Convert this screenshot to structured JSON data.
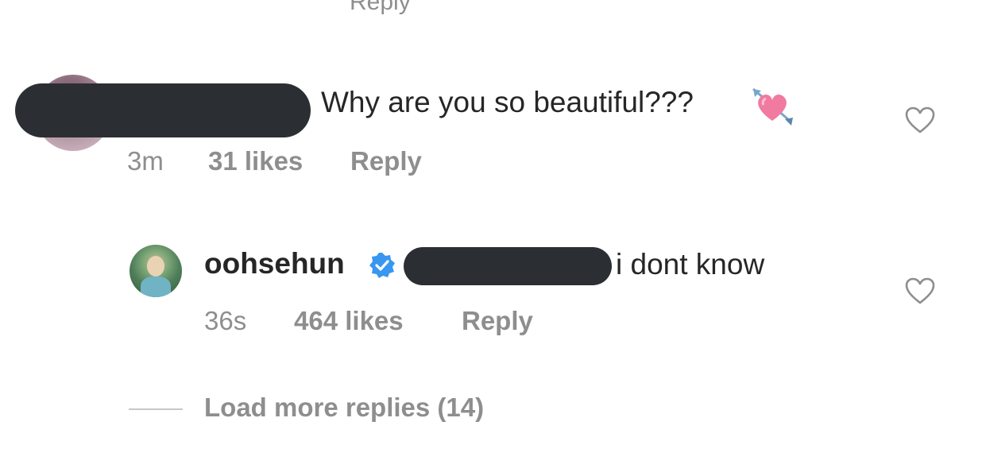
{
  "top_cutoff": {
    "text": "Reply"
  },
  "comment1": {
    "username_redacted": true,
    "text": "Why are you so beautiful???",
    "emoji_icon": "heart-with-arrow-icon",
    "time": "3m",
    "likes": "31 likes",
    "reply_label": "Reply"
  },
  "reply1": {
    "username": "oohsehun",
    "verified_icon": "verified-badge-icon",
    "mention_redacted": true,
    "text": "i dont know",
    "time": "36s",
    "likes": "464 likes",
    "reply_label": "Reply"
  },
  "load_more": {
    "label": "Load more replies (14)"
  },
  "colors": {
    "text_primary": "#262626",
    "text_secondary": "#8e8e8e",
    "redaction": "#2b2f33",
    "verified_blue": "#3897f0"
  }
}
